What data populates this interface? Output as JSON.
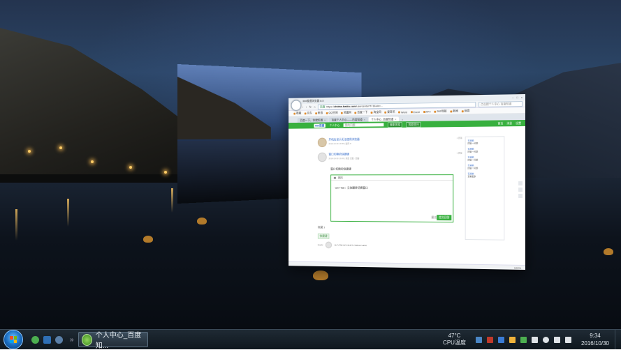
{
  "browser": {
    "window_title": "360极速浏览器 8.5",
    "address_secure_label": "百度",
    "address_host": "zhidao.baidu.com",
    "address_path": "/usercenter?t=1&uid=...",
    "search_placeholder": "点击搜个人中心 百度知道",
    "bookmarks": [
      "收藏",
      "京东",
      "新浪",
      "QQ空间",
      "凤凰网",
      "百度一下",
      "淘宝网",
      "爱奇艺",
      "Word",
      "Excel",
      "PPT",
      "360导航",
      "新闻",
      "体育"
    ],
    "tabs": [
      {
        "label": "百度一下，你就知道"
      },
      {
        "label": "百度个人中心——百度知道"
      },
      {
        "label": "个人中心_百度知道"
      }
    ],
    "header": {
      "logo": "Bai百度",
      "section": "个人中心",
      "query_placeholder": "我的问题",
      "search_btn": "搜索答案",
      "ask_btn": "我要提问",
      "right_links": [
        "首页",
        "消息",
        "设置"
      ]
    },
    "posts": [
      {
        "title": "开机后显示无法使用浏览器",
        "meta": "2016-10-30 10:30 | 追问 0",
        "time": "1 回答"
      },
      {
        "title": "窗口切换的快捷键",
        "meta": "2016-10-30 10:26 | 浏览 次数 · 回答",
        "time": "1 回答"
      }
    ],
    "question_title": "窗口切换的快捷键",
    "answer_toolbar": "图片",
    "answer_text": "win+Tab：立体翻转切换窗口",
    "anonymous_label": "匿名",
    "submit_label": "提交回答",
    "collect_label": "收藏 1",
    "tag_label": "快捷键",
    "reply_user": "fenchi",
    "reply_text": "ALT+TAB ALT+SHIFT+TAB ALT+ESC",
    "sidebar": [
      {
        "title": "已采纳",
        "sub": "回答一问题"
      },
      {
        "title": "已采纳",
        "sub": "回答一问题"
      },
      {
        "title": "已采纳",
        "sub": "回答一问题"
      },
      {
        "title": "已采纳",
        "sub": "回答一问题"
      },
      {
        "title": "已采纳",
        "sub": "查看更多"
      }
    ],
    "status_zoom": "100%"
  },
  "taskbar": {
    "task_label": "个人中心_百度知...",
    "more_arrow": "»",
    "temp_value": "47°C",
    "temp_label": "CPU温度",
    "time": "9:34",
    "date": "2016/10/30"
  },
  "colors": {
    "baidu_green": "#38b03f",
    "link_blue": "#2a64c7",
    "taskbar": "#0f171e"
  }
}
